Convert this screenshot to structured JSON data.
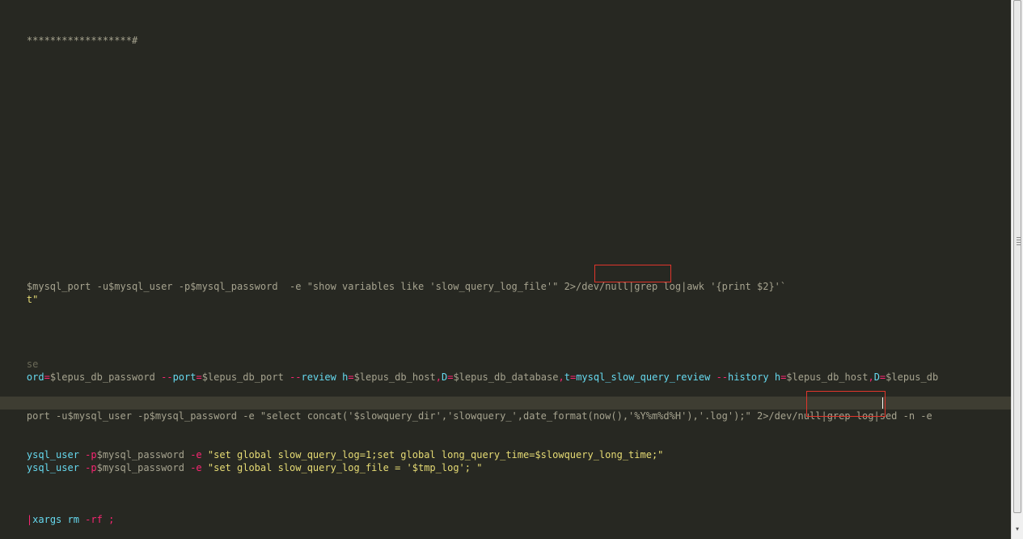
{
  "editor": {
    "lines": {
      "l1": "******************#",
      "l2": {
        "a": "$mysql_port -u$mysql_user -p$mysql_password  -e \"show variables like 'slow_query_log_file'\" ",
        "b": "2>/dev/null",
        "c": "|grep log|awk '{print $2}'`"
      },
      "l3": "t\"",
      "l4": "se",
      "l5": {
        "t1": "ord",
        "t2": "=",
        "t3": "$lepus_db_password ",
        "t4": "--",
        "t5": "port",
        "t6": "=",
        "t7": "$lepus_db_port ",
        "t8": "--",
        "t9": "review",
        "t10": " h",
        "t11": "=",
        "t12": "$lepus_db_host",
        "t13": ",",
        "t14": "D",
        "t15": "=",
        "t16": "$lepus_db_database",
        "t17": ",",
        "t18": "t",
        "t19": "=",
        "t20": "mysql_slow_query_review ",
        "t21": "--",
        "t22": "history",
        "t23": " h",
        "t24": "=",
        "t25": "$lepus_db_host",
        "t26": ",",
        "t27": "D",
        "t28": "=",
        "t29": "$lepus_db"
      },
      "l6": {
        "a": "port -u$mysql_user -p$mysql_password -e \"select concat('$slowquery_dir','slowquery_',date_format(now(),'%Y%m%d%H'),'.log');\" ",
        "b": "2>/dev/null",
        "c": "|grep log|sed -n -e"
      },
      "l7": {
        "t1": "ysql_user ",
        "t2": "-p",
        "t3": "$mysql_password ",
        "t4": "-e",
        "t5": " \"set global slow_query_log=1;set global long_query_time=$slowquery_long_time;\""
      },
      "l8": {
        "t1": "ysql_user ",
        "t2": "-p",
        "t3": "$mysql_password ",
        "t4": "-e",
        "t5": " \"set global slow_query_log_file = '$tmp_log'; \""
      },
      "l9": {
        "t1": "|",
        "t2": "xargs",
        "t3": " rm ",
        "t4": "-rf",
        "t5": " ;"
      }
    }
  }
}
